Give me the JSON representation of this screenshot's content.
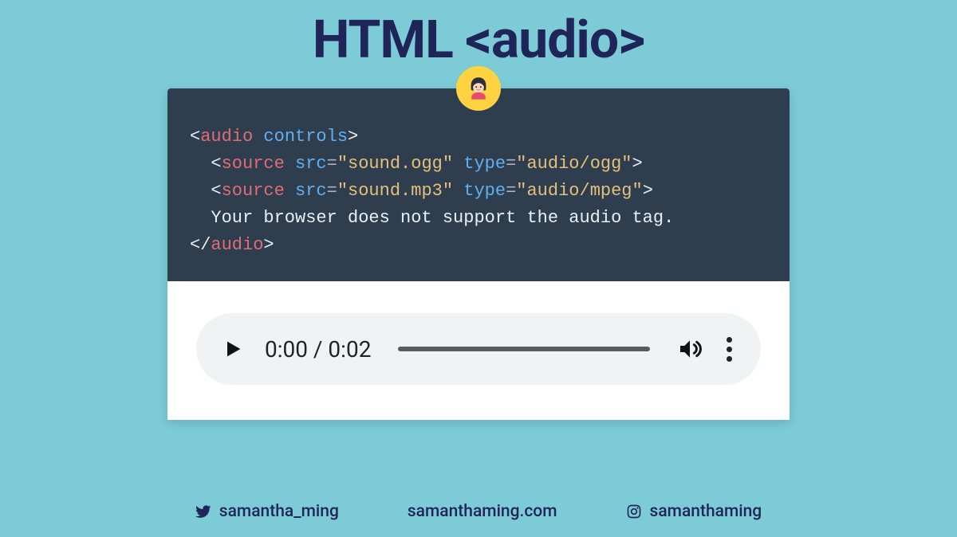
{
  "title": "HTML <audio>",
  "code": {
    "tag_audio_open": "audio",
    "attr_controls": "controls",
    "tag_source": "source",
    "attr_src": "src",
    "attr_type": "type",
    "val_src1": "\"sound.ogg\"",
    "val_type1": "\"audio/ogg\"",
    "val_src2": "\"sound.mp3\"",
    "val_type2": "\"audio/mpeg\"",
    "fallback_text": "Your browser does not support the audio tag.",
    "tag_audio_close": "audio"
  },
  "player": {
    "time": "0:00 / 0:02"
  },
  "footer": {
    "twitter": "samantha_ming",
    "website": "samanthaming.com",
    "instagram": "samanthaming"
  }
}
